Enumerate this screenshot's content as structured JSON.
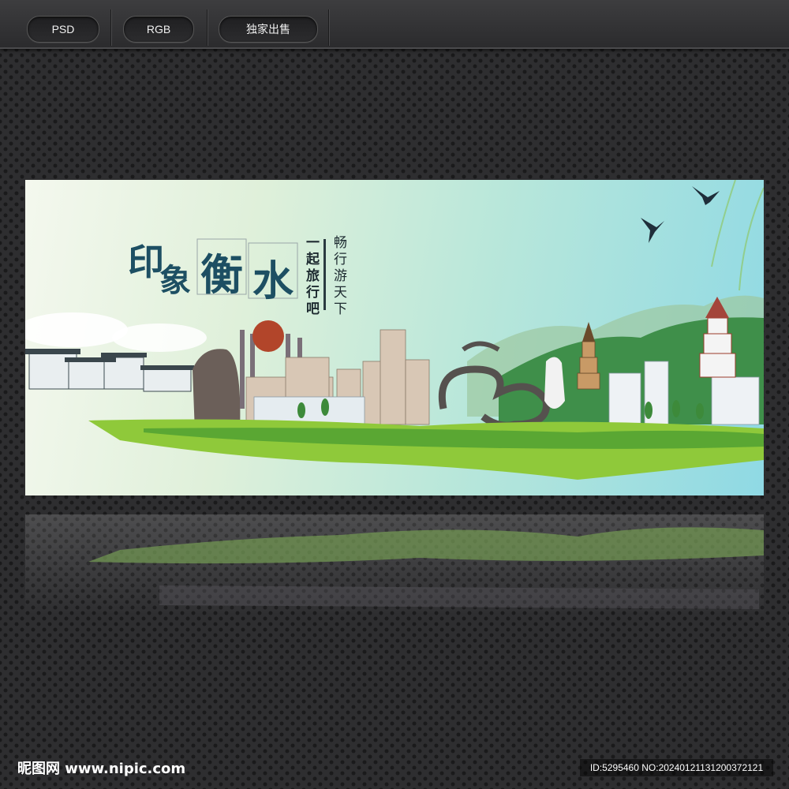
{
  "toolbar": {
    "tags": [
      {
        "label": "PSD"
      },
      {
        "label": "RGB"
      },
      {
        "label": "独家出售"
      }
    ]
  },
  "poster": {
    "title_chars": [
      "印",
      "象",
      "衡",
      "水"
    ],
    "subtitle": "一起旅行吧",
    "tagline": "畅行游天下"
  },
  "footer": {
    "logo": "昵图网 www.nipic.com",
    "id_text": "ID:5295460 NO:20240121131200372121"
  }
}
